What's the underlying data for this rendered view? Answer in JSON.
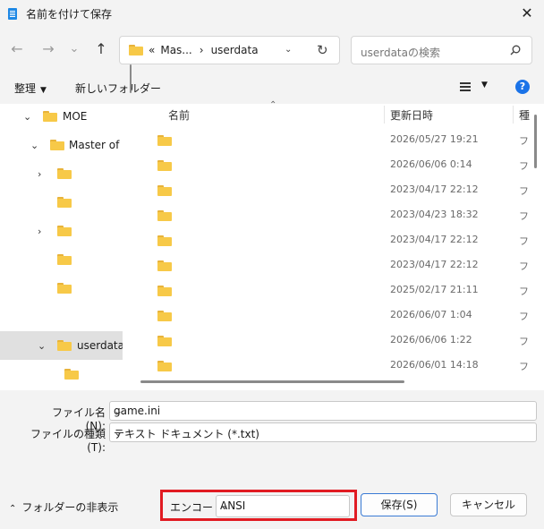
{
  "window": {
    "title": "名前を付けて保存",
    "close": "✕"
  },
  "nav": {
    "back": "←",
    "forward": "→",
    "dropdown": "⌄",
    "up": "↑",
    "address": {
      "parts": [
        "«",
        "Mas...",
        "›",
        "userdata"
      ],
      "refresh": "↻"
    },
    "search": {
      "placeholder": "userdataの検索"
    }
  },
  "toolbar": {
    "organize": "整理",
    "new_folder": "新しいフォルダー",
    "help": "?"
  },
  "tree": {
    "items": [
      {
        "label": "MOE",
        "expanded": true
      },
      {
        "label": "Master of E",
        "expanded": true
      },
      {
        "label": "",
        "expanded": false
      },
      {
        "label": "",
        "expanded": null
      },
      {
        "label": "",
        "expanded": false
      },
      {
        "label": "",
        "expanded": null
      },
      {
        "label": "",
        "expanded": null
      },
      {
        "label": "userdata",
        "expanded": true,
        "selected": true
      },
      {
        "label": "",
        "expanded": null
      }
    ]
  },
  "columns": {
    "name": "名前",
    "modified": "更新日時",
    "type": "種"
  },
  "files": [
    {
      "date": "2026/05/27 19:21",
      "type": "フ"
    },
    {
      "date": "2026/06/06 0:14",
      "type": "フ"
    },
    {
      "date": "2023/04/17 22:12",
      "type": "フ"
    },
    {
      "date": "2023/04/23 18:32",
      "type": "フ"
    },
    {
      "date": "2023/04/17 22:12",
      "type": "フ"
    },
    {
      "date": "2023/04/17 22:12",
      "type": "フ"
    },
    {
      "date": "2025/02/17 21:11",
      "type": "フ"
    },
    {
      "date": "2026/06/07 1:04",
      "type": "フ"
    },
    {
      "date": "2026/06/06 1:22",
      "type": "フ"
    },
    {
      "date": "2026/06/01 14:18",
      "type": "フ"
    }
  ],
  "form": {
    "filename_label": "ファイル名(N):",
    "filename_value": "game.ini",
    "filetype_label": "ファイルの種類(T):",
    "filetype_value": "テキスト ドキュメント (*.txt)"
  },
  "footer": {
    "hide_folders": "フォルダーの非表示",
    "encode_label": "エンコード:",
    "encode_value": "ANSI",
    "save": "保存(S)",
    "cancel": "キャンセル"
  },
  "colors": {
    "highlight_border": "#e11b22",
    "folder": "#f7c948",
    "accent": "#1a73e8"
  }
}
